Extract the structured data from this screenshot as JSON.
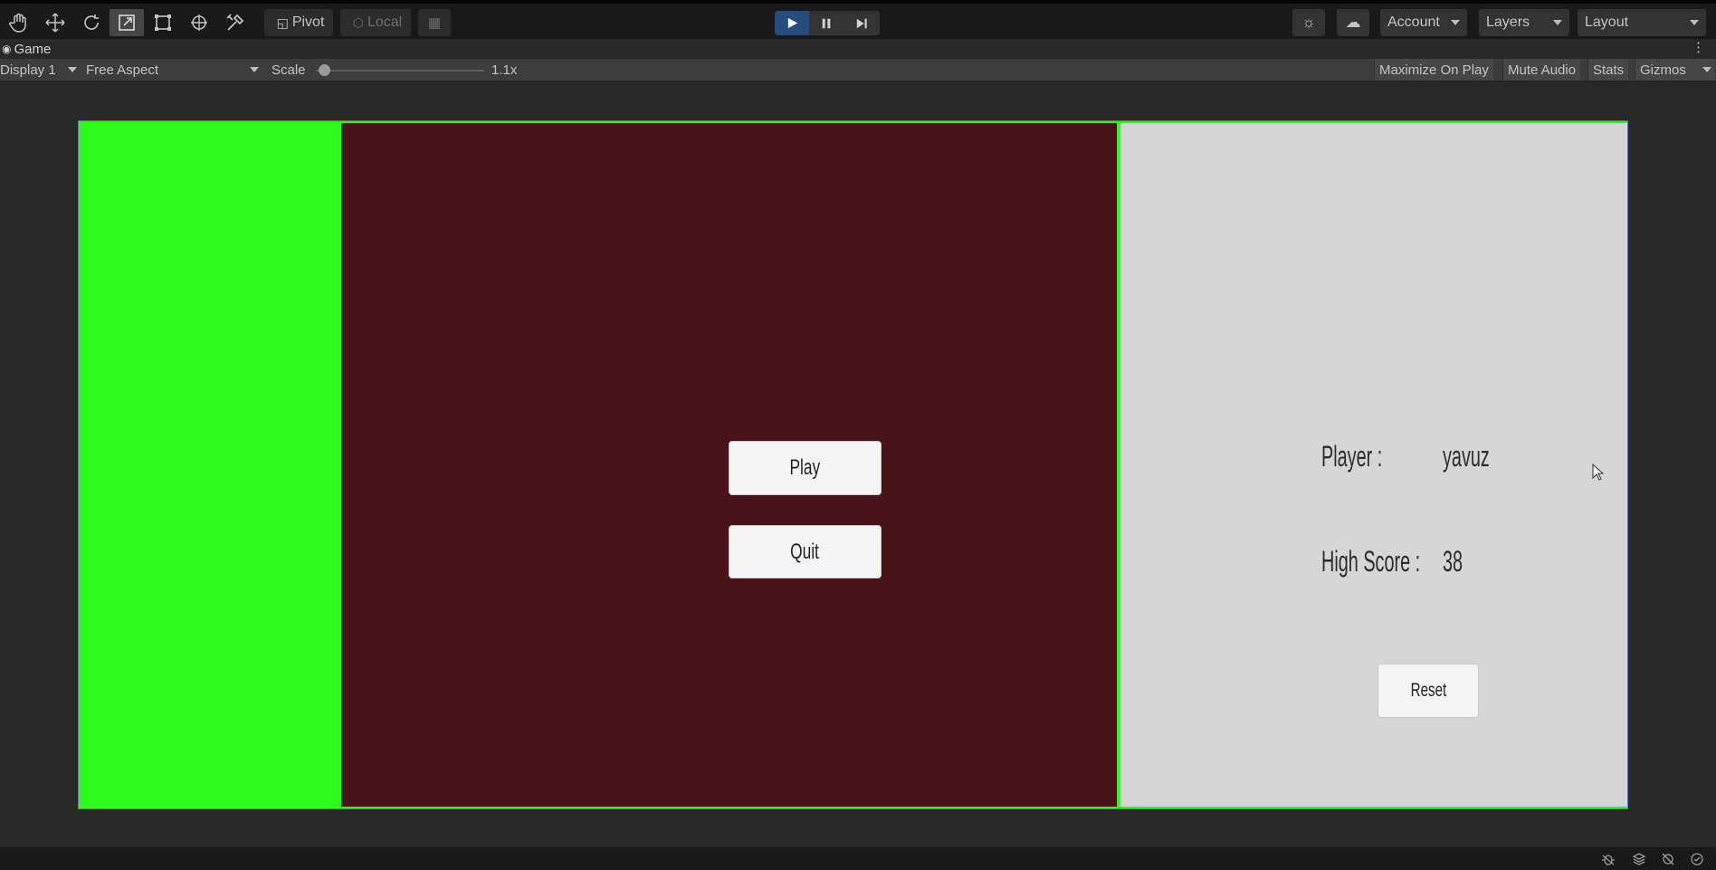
{
  "toolbar": {
    "tools": [
      "hand-icon",
      "move-icon",
      "rotate-icon",
      "scale-icon",
      "rect-transform-icon",
      "transform-icon",
      "custom-tool-icon"
    ],
    "active_tool": "scale-icon",
    "pivot_label": "Pivot",
    "local_label": "Local",
    "account_label": "Account",
    "layers_label": "Layers",
    "layout_label": "Layout",
    "play_active": true
  },
  "tab": {
    "title": "Game"
  },
  "gamebar": {
    "display": "Display 1",
    "aspect": "Free Aspect",
    "scale_label": "Scale",
    "scale_value": "1.1x",
    "scale_fraction": 0.05,
    "maximize_label": "Maximize On Play",
    "mute_label": "Mute Audio",
    "stats_label": "Stats",
    "gizmos_label": "Gizmos"
  },
  "game": {
    "colors": {
      "left": "#2dfb1c",
      "center": "#471218",
      "right": "#d6d6d6"
    },
    "play_label": "Play",
    "quit_label": "Quit",
    "player_label": "Player :",
    "player_value": "yavuz",
    "highscore_label": "High Score :",
    "highscore_value": "38",
    "reset_label": "Reset"
  }
}
